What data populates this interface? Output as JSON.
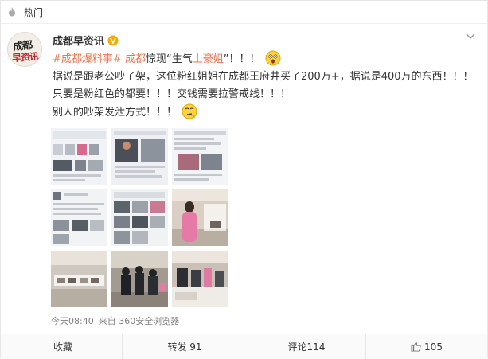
{
  "topbar": {
    "label": "热门",
    "icon": "fire-icon"
  },
  "post": {
    "author": "成都早资讯",
    "avatar_text_top": "成都",
    "avatar_text_bottom": "早资讯",
    "content": {
      "topic_a": "#成都爆料事#",
      "city": "成都",
      "text_a": "惊现“生气",
      "highlight": "土豪姐",
      "text_b": "”！！！",
      "line2": "据说是跟老公吵了架，这位粉红姐姐在成都王府井买了200万+，据说是400万的东西！！！只要是粉红色的都要！！！交钱需要拉警戒线！！！",
      "line3": "别人的吵架发泄方式！！！"
    },
    "meta": {
      "time": "今天08:40",
      "source": "来自 360安全浏览器"
    }
  },
  "actions": {
    "favorite": "收藏",
    "repost": "转发 91",
    "comment": "评论114",
    "like": "105"
  },
  "colors": {
    "link": "#eb7350",
    "meta": "#808080",
    "text": "#333333"
  }
}
